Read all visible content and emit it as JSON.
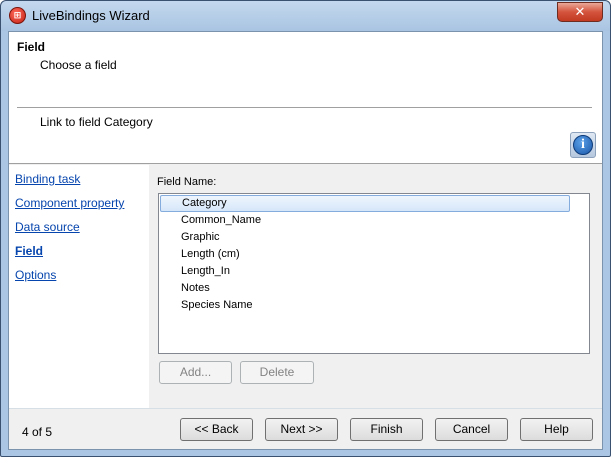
{
  "window": {
    "title": "LiveBindings Wizard",
    "close_label": "✕"
  },
  "header": {
    "title": "Field",
    "subtitle": "Choose a field",
    "link_info": "Link to field Category"
  },
  "steps": [
    {
      "label": "Binding task",
      "current": false
    },
    {
      "label": "Component property",
      "current": false
    },
    {
      "label": "Data source",
      "current": false
    },
    {
      "label": "Field",
      "current": true
    },
    {
      "label": "Options",
      "current": false
    }
  ],
  "content": {
    "field_label": "Field Name:",
    "fields": [
      "Category",
      "Common_Name",
      "Graphic",
      "Length (cm)",
      "Length_In",
      "Notes",
      "Species Name"
    ],
    "selected_field": "Category",
    "add_label": "Add...",
    "delete_label": "Delete"
  },
  "footer": {
    "page_counter": "4 of 5",
    "back_label": "<< Back",
    "next_label": "Next >>",
    "finish_label": "Finish",
    "cancel_label": "Cancel",
    "help_label": "Help"
  },
  "colors": {
    "accent": "#0645ad",
    "title_bar": "#aac6e4",
    "selection": "#d6e7fa"
  }
}
